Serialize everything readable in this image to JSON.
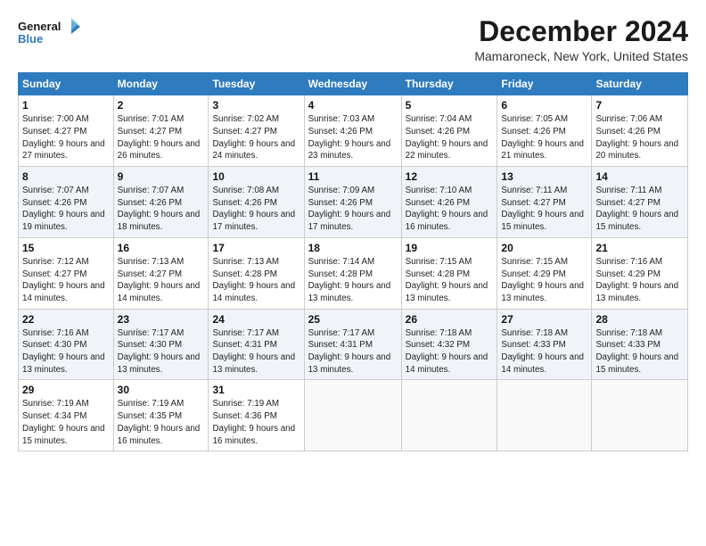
{
  "logo": {
    "line1": "General",
    "line2": "Blue"
  },
  "title": "December 2024",
  "location": "Mamaroneck, New York, United States",
  "days_of_week": [
    "Sunday",
    "Monday",
    "Tuesday",
    "Wednesday",
    "Thursday",
    "Friday",
    "Saturday"
  ],
  "weeks": [
    [
      {
        "day": "1",
        "sunrise": "Sunrise: 7:00 AM",
        "sunset": "Sunset: 4:27 PM",
        "daylight": "Daylight: 9 hours and 27 minutes."
      },
      {
        "day": "2",
        "sunrise": "Sunrise: 7:01 AM",
        "sunset": "Sunset: 4:27 PM",
        "daylight": "Daylight: 9 hours and 26 minutes."
      },
      {
        "day": "3",
        "sunrise": "Sunrise: 7:02 AM",
        "sunset": "Sunset: 4:27 PM",
        "daylight": "Daylight: 9 hours and 24 minutes."
      },
      {
        "day": "4",
        "sunrise": "Sunrise: 7:03 AM",
        "sunset": "Sunset: 4:26 PM",
        "daylight": "Daylight: 9 hours and 23 minutes."
      },
      {
        "day": "5",
        "sunrise": "Sunrise: 7:04 AM",
        "sunset": "Sunset: 4:26 PM",
        "daylight": "Daylight: 9 hours and 22 minutes."
      },
      {
        "day": "6",
        "sunrise": "Sunrise: 7:05 AM",
        "sunset": "Sunset: 4:26 PM",
        "daylight": "Daylight: 9 hours and 21 minutes."
      },
      {
        "day": "7",
        "sunrise": "Sunrise: 7:06 AM",
        "sunset": "Sunset: 4:26 PM",
        "daylight": "Daylight: 9 hours and 20 minutes."
      }
    ],
    [
      {
        "day": "8",
        "sunrise": "Sunrise: 7:07 AM",
        "sunset": "Sunset: 4:26 PM",
        "daylight": "Daylight: 9 hours and 19 minutes."
      },
      {
        "day": "9",
        "sunrise": "Sunrise: 7:07 AM",
        "sunset": "Sunset: 4:26 PM",
        "daylight": "Daylight: 9 hours and 18 minutes."
      },
      {
        "day": "10",
        "sunrise": "Sunrise: 7:08 AM",
        "sunset": "Sunset: 4:26 PM",
        "daylight": "Daylight: 9 hours and 17 minutes."
      },
      {
        "day": "11",
        "sunrise": "Sunrise: 7:09 AM",
        "sunset": "Sunset: 4:26 PM",
        "daylight": "Daylight: 9 hours and 17 minutes."
      },
      {
        "day": "12",
        "sunrise": "Sunrise: 7:10 AM",
        "sunset": "Sunset: 4:26 PM",
        "daylight": "Daylight: 9 hours and 16 minutes."
      },
      {
        "day": "13",
        "sunrise": "Sunrise: 7:11 AM",
        "sunset": "Sunset: 4:27 PM",
        "daylight": "Daylight: 9 hours and 15 minutes."
      },
      {
        "day": "14",
        "sunrise": "Sunrise: 7:11 AM",
        "sunset": "Sunset: 4:27 PM",
        "daylight": "Daylight: 9 hours and 15 minutes."
      }
    ],
    [
      {
        "day": "15",
        "sunrise": "Sunrise: 7:12 AM",
        "sunset": "Sunset: 4:27 PM",
        "daylight": "Daylight: 9 hours and 14 minutes."
      },
      {
        "day": "16",
        "sunrise": "Sunrise: 7:13 AM",
        "sunset": "Sunset: 4:27 PM",
        "daylight": "Daylight: 9 hours and 14 minutes."
      },
      {
        "day": "17",
        "sunrise": "Sunrise: 7:13 AM",
        "sunset": "Sunset: 4:28 PM",
        "daylight": "Daylight: 9 hours and 14 minutes."
      },
      {
        "day": "18",
        "sunrise": "Sunrise: 7:14 AM",
        "sunset": "Sunset: 4:28 PM",
        "daylight": "Daylight: 9 hours and 13 minutes."
      },
      {
        "day": "19",
        "sunrise": "Sunrise: 7:15 AM",
        "sunset": "Sunset: 4:28 PM",
        "daylight": "Daylight: 9 hours and 13 minutes."
      },
      {
        "day": "20",
        "sunrise": "Sunrise: 7:15 AM",
        "sunset": "Sunset: 4:29 PM",
        "daylight": "Daylight: 9 hours and 13 minutes."
      },
      {
        "day": "21",
        "sunrise": "Sunrise: 7:16 AM",
        "sunset": "Sunset: 4:29 PM",
        "daylight": "Daylight: 9 hours and 13 minutes."
      }
    ],
    [
      {
        "day": "22",
        "sunrise": "Sunrise: 7:16 AM",
        "sunset": "Sunset: 4:30 PM",
        "daylight": "Daylight: 9 hours and 13 minutes."
      },
      {
        "day": "23",
        "sunrise": "Sunrise: 7:17 AM",
        "sunset": "Sunset: 4:30 PM",
        "daylight": "Daylight: 9 hours and 13 minutes."
      },
      {
        "day": "24",
        "sunrise": "Sunrise: 7:17 AM",
        "sunset": "Sunset: 4:31 PM",
        "daylight": "Daylight: 9 hours and 13 minutes."
      },
      {
        "day": "25",
        "sunrise": "Sunrise: 7:17 AM",
        "sunset": "Sunset: 4:31 PM",
        "daylight": "Daylight: 9 hours and 13 minutes."
      },
      {
        "day": "26",
        "sunrise": "Sunrise: 7:18 AM",
        "sunset": "Sunset: 4:32 PM",
        "daylight": "Daylight: 9 hours and 14 minutes."
      },
      {
        "day": "27",
        "sunrise": "Sunrise: 7:18 AM",
        "sunset": "Sunset: 4:33 PM",
        "daylight": "Daylight: 9 hours and 14 minutes."
      },
      {
        "day": "28",
        "sunrise": "Sunrise: 7:18 AM",
        "sunset": "Sunset: 4:33 PM",
        "daylight": "Daylight: 9 hours and 15 minutes."
      }
    ],
    [
      {
        "day": "29",
        "sunrise": "Sunrise: 7:19 AM",
        "sunset": "Sunset: 4:34 PM",
        "daylight": "Daylight: 9 hours and 15 minutes."
      },
      {
        "day": "30",
        "sunrise": "Sunrise: 7:19 AM",
        "sunset": "Sunset: 4:35 PM",
        "daylight": "Daylight: 9 hours and 16 minutes."
      },
      {
        "day": "31",
        "sunrise": "Sunrise: 7:19 AM",
        "sunset": "Sunset: 4:36 PM",
        "daylight": "Daylight: 9 hours and 16 minutes."
      },
      null,
      null,
      null,
      null
    ]
  ]
}
